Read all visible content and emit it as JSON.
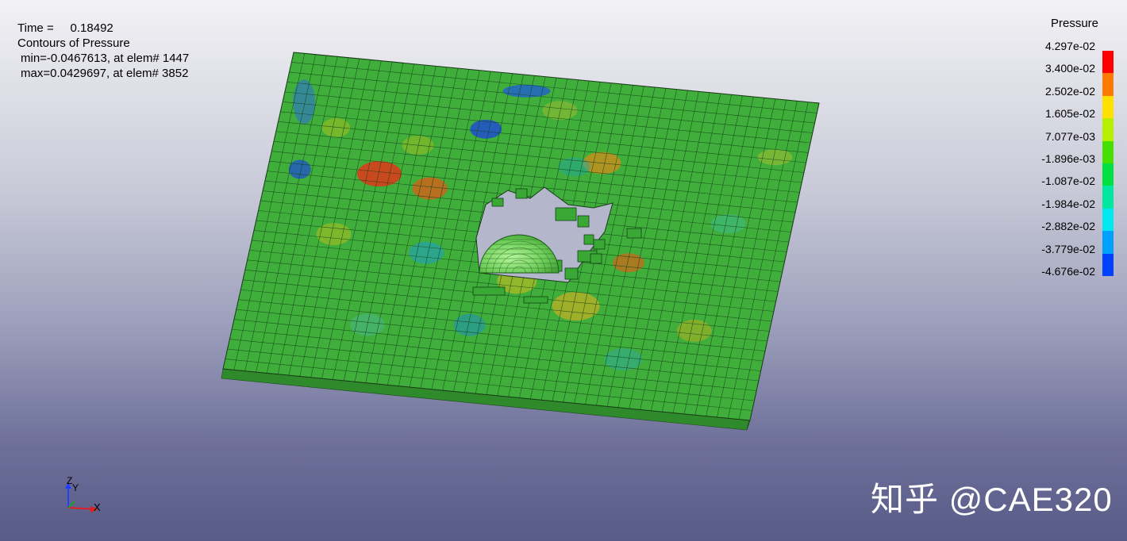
{
  "info": {
    "time_label": "Time =",
    "time_value": "0.18492",
    "title": "Contours of Pressure",
    "min_line": "min=-0.0467613, at elem# 1447",
    "max_line": "max=0.0429697, at elem# 3852"
  },
  "legend": {
    "title": "Pressure",
    "labels": [
      "4.297e-02",
      "3.400e-02",
      "2.502e-02",
      "1.605e-02",
      "7.077e-03",
      "-1.896e-03",
      "-1.087e-02",
      "-1.984e-02",
      "-2.882e-02",
      "-3.779e-02",
      "-4.676e-02"
    ],
    "colors": [
      "#ff0000",
      "#ff7a00",
      "#ffe000",
      "#b4f000",
      "#46e000",
      "#00e040",
      "#00e8a0",
      "#00e8f0",
      "#00a0ff",
      "#0040ff"
    ]
  },
  "model": {
    "plate_base_color": "#3fae3a",
    "sphere_color": "#7ad86a"
  },
  "triad": {
    "x_label": "X",
    "y_label": "Y",
    "z_label": "Z"
  },
  "watermark": "知乎 @CAE320"
}
